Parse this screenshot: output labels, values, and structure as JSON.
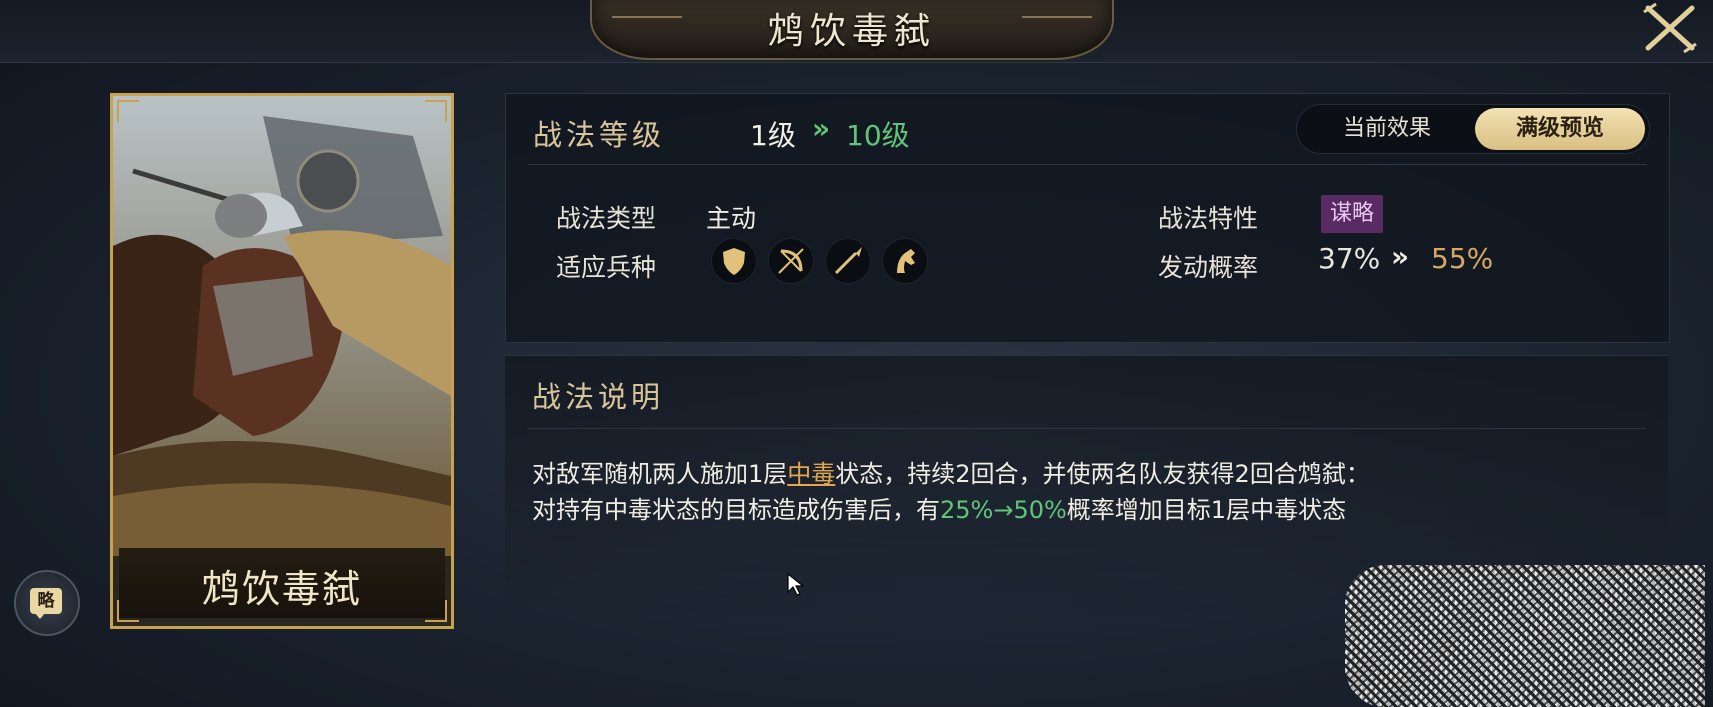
{
  "header": {
    "title": "鸩饮毒弑"
  },
  "card": {
    "name": "鸩饮毒弑",
    "badge_label": "略"
  },
  "level": {
    "label": "战法等级",
    "from": "1级",
    "arrow": "»",
    "to": "10级"
  },
  "toggle": {
    "current_label": "当前效果",
    "max_label": "满级预览",
    "selected": "满级预览"
  },
  "info": {
    "type_label": "战法类型",
    "type_value": "主动",
    "units_label": "适应兵种",
    "units": [
      "shield-icon",
      "bow-icon",
      "spear-icon",
      "horse-icon"
    ],
    "trait_label": "战法特性",
    "trait_value": "谋略",
    "rate_label": "发动概率",
    "rate_from": "37%",
    "rate_arrow": "»",
    "rate_to": "55%"
  },
  "description": {
    "title": "战法说明",
    "line1_a": "对敌军随机两人施加1层",
    "line1_hl": "中毒",
    "line1_b": "状态，持续2回合，并使两名队友获得2回合鸩弑：",
    "line2_a": "对持有中毒状态的目标造成伤害后，有",
    "line2_hl": "25%→50%",
    "line2_b": "概率增加目标1层中毒状态"
  },
  "colors": {
    "gold": "#c9a24f",
    "green": "#62c47a",
    "orange": "#d8a763",
    "trait_bg": "#5a2b63"
  }
}
